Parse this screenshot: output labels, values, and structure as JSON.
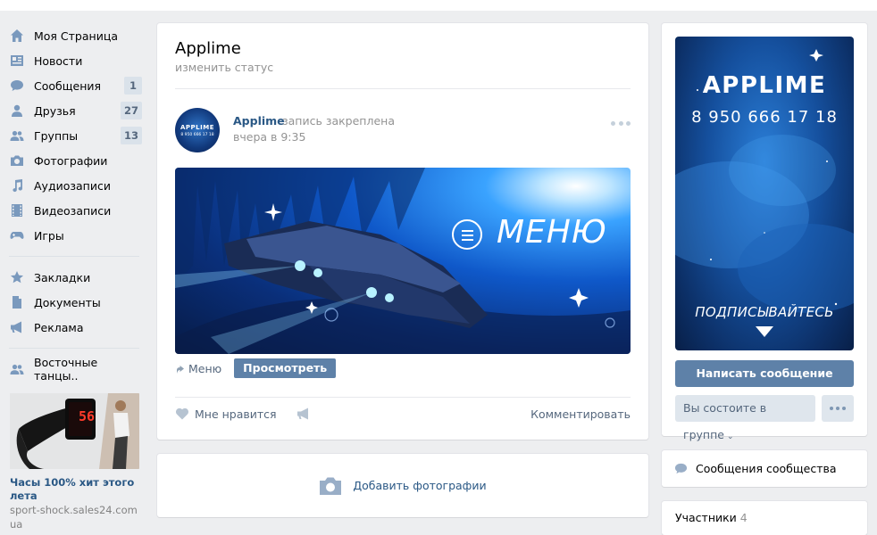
{
  "sidebar": {
    "items": [
      {
        "label": "Моя Страница",
        "icon": "home-icon"
      },
      {
        "label": "Новости",
        "icon": "news-icon"
      },
      {
        "label": "Сообщения",
        "icon": "messages-icon",
        "count": "1"
      },
      {
        "label": "Друзья",
        "icon": "friends-icon",
        "count": "27"
      },
      {
        "label": "Группы",
        "icon": "groups-icon",
        "count": "13"
      },
      {
        "label": "Фотографии",
        "icon": "camera-icon"
      },
      {
        "label": "Аудиозаписи",
        "icon": "music-icon"
      },
      {
        "label": "Видеозаписи",
        "icon": "film-icon"
      },
      {
        "label": "Игры",
        "icon": "gamepad-icon"
      }
    ],
    "items2": [
      {
        "label": "Закладки",
        "icon": "star-icon"
      },
      {
        "label": "Документы",
        "icon": "document-icon"
      },
      {
        "label": "Реклама",
        "icon": "megaphone-icon"
      }
    ],
    "items3": [
      {
        "label": "Восточные танцы..",
        "icon": "group-icon"
      }
    ],
    "ad": {
      "title": "Часы 100% хит этого лета",
      "url": "sport-shock.sales24.com",
      "url_cont": "ua",
      "watch_digits": "56"
    }
  },
  "group": {
    "title": "Applime",
    "status_link": "изменить статус"
  },
  "post": {
    "avatar_title": "APPLIME",
    "avatar_phone": "8 950 666 17 18",
    "author": "Applime",
    "pinned": "запись закреплена",
    "time": "вчера в 9:35",
    "banner_text": "МЕНЮ",
    "link_label": "Меню",
    "view_button": "Просмотреть",
    "like_label": "Мне нравится",
    "comment_label": "Комментировать"
  },
  "photos": {
    "add_label": "Добавить фотографии"
  },
  "cover": {
    "brand": "APPLIME",
    "phone": "8 950 666 17 18",
    "subscribe": "ПОДПИСЫВАЙТЕСЬ"
  },
  "actions": {
    "message_button": "Написать сообщение",
    "member_button": "Вы состоите в группе",
    "chevron": "⌄"
  },
  "community_messages": {
    "label": "Сообщения сообщества"
  },
  "members": {
    "label": "Участники",
    "count": "4"
  },
  "colors": {
    "accent": "#5e81a8",
    "link": "#2a5885",
    "background": "#edeef0"
  }
}
